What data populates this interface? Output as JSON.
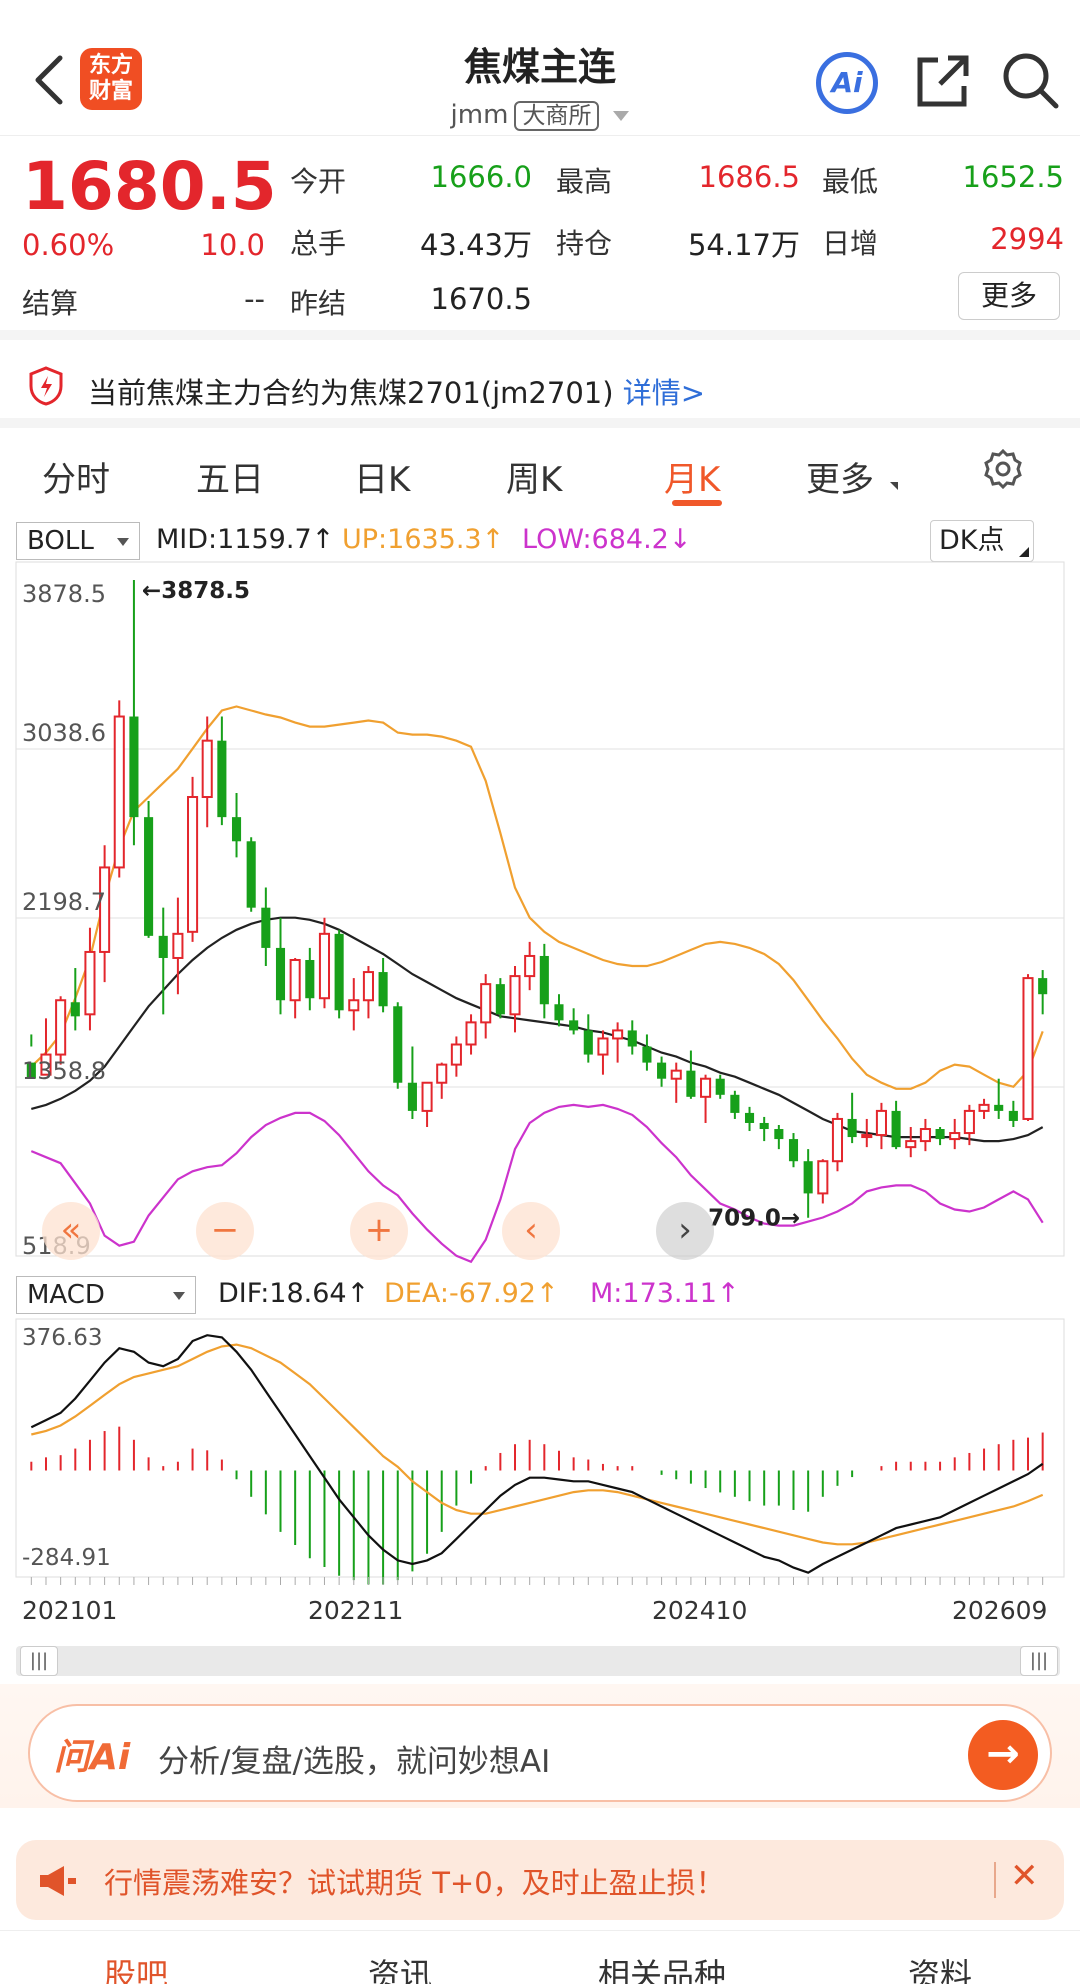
{
  "header": {
    "title": "焦煤主连",
    "code": "jmm",
    "exchange": "大商所",
    "logo_line1": "东方",
    "logo_line2": "财富",
    "ai_label": "Ai"
  },
  "quote": {
    "price": "1680.5",
    "change_pct": "0.60%",
    "change": "10.0",
    "settle_label": "结算",
    "settle_value": "--",
    "open_label": "今开",
    "open_value": "1666.0",
    "high_label": "最高",
    "high_value": "1686.5",
    "low_label": "最低",
    "low_value": "1652.5",
    "volume_label": "总手",
    "volume_value": "43.43万",
    "oi_label": "持仓",
    "oi_value": "54.17万",
    "daily_inc_label": "日增",
    "daily_inc_value": "2994",
    "prev_settle_label": "昨结",
    "prev_settle_value": "1670.5",
    "more_label": "更多"
  },
  "notice": {
    "text": "当前焦煤主力合约为焦煤2701(jm2701)",
    "link": "详情>"
  },
  "tabs": [
    "分时",
    "五日",
    "日K",
    "周K",
    "月K",
    "更多"
  ],
  "active_tab": "月K",
  "boll": {
    "selector": "BOLL",
    "mid": "MID:1159.7↑",
    "up": "UP:1635.3↑",
    "low": "LOW:684.2↓",
    "dk_label": "DK点"
  },
  "macd": {
    "selector": "MACD",
    "dif": "DIF:18.64↑",
    "dea": "DEA:-67.92↑",
    "m": "M:173.11↑"
  },
  "colors": {
    "up": "#e3262c",
    "down": "#17a01a",
    "boll_up": "#f0a030",
    "boll_mid": "#222222",
    "boll_low": "#cc33cc",
    "accent": "#f0582a"
  },
  "chart_data": {
    "type": "candlestick",
    "y_ticks": [
      "3878.5",
      "3038.6",
      "2198.7",
      "1358.8",
      "518.9"
    ],
    "ylim": [
      518.9,
      3878.5
    ],
    "max_marker": "←3878.5",
    "min_marker": "709.0→",
    "x_labels": [
      "202101",
      "202211",
      "202410",
      "202609"
    ],
    "candles": [
      [
        1480,
        1620,
        1560,
        1400
      ],
      [
        1420,
        1700,
        1450,
        1520
      ],
      [
        1520,
        1810,
        1470,
        1790
      ],
      [
        1780,
        1950,
        1640,
        1710
      ],
      [
        1720,
        2150,
        1640,
        2030
      ],
      [
        2030,
        2560,
        1880,
        2450
      ],
      [
        2450,
        3280,
        2400,
        3200
      ],
      [
        3200,
        3878.5,
        2560,
        2700
      ],
      [
        2700,
        2780,
        2100,
        2110
      ],
      [
        2110,
        2250,
        1720,
        2000
      ],
      [
        2000,
        2300,
        1820,
        2120
      ],
      [
        2130,
        2900,
        2080,
        2800
      ],
      [
        2800,
        3200,
        2650,
        3080
      ],
      [
        3080,
        3200,
        2660,
        2700
      ],
      [
        2700,
        2820,
        2500,
        2580
      ],
      [
        2580,
        2600,
        2230,
        2250
      ],
      [
        2250,
        2350,
        1960,
        2050
      ],
      [
        2050,
        2200,
        1720,
        1790
      ],
      [
        1790,
        2000,
        1700,
        1990
      ],
      [
        1990,
        2050,
        1740,
        1800
      ],
      [
        1800,
        2200,
        1750,
        2120
      ],
      [
        2120,
        2140,
        1700,
        1740
      ],
      [
        1740,
        1900,
        1640,
        1790
      ],
      [
        1790,
        1960,
        1700,
        1930
      ],
      [
        1930,
        2000,
        1730,
        1760
      ],
      [
        1760,
        1780,
        1350,
        1380
      ],
      [
        1380,
        1560,
        1200,
        1240
      ],
      [
        1240,
        1380,
        1160,
        1380
      ],
      [
        1380,
        1480,
        1300,
        1470
      ],
      [
        1470,
        1610,
        1410,
        1570
      ],
      [
        1570,
        1720,
        1520,
        1680
      ],
      [
        1680,
        1920,
        1600,
        1870
      ],
      [
        1870,
        1900,
        1700,
        1720
      ],
      [
        1720,
        1960,
        1630,
        1910
      ],
      [
        1910,
        2080,
        1840,
        2010
      ],
      [
        2010,
        2070,
        1700,
        1770
      ],
      [
        1770,
        1820,
        1660,
        1690
      ],
      [
        1690,
        1750,
        1620,
        1640
      ],
      [
        1640,
        1720,
        1480,
        1520
      ],
      [
        1520,
        1640,
        1420,
        1600
      ],
      [
        1600,
        1680,
        1480,
        1640
      ],
      [
        1640,
        1690,
        1520,
        1560
      ],
      [
        1560,
        1620,
        1440,
        1480
      ],
      [
        1480,
        1510,
        1360,
        1400
      ],
      [
        1400,
        1480,
        1280,
        1440
      ],
      [
        1440,
        1540,
        1300,
        1310
      ],
      [
        1310,
        1420,
        1180,
        1400
      ],
      [
        1400,
        1420,
        1300,
        1320
      ],
      [
        1320,
        1340,
        1200,
        1230
      ],
      [
        1230,
        1260,
        1140,
        1180
      ],
      [
        1180,
        1210,
        1090,
        1150
      ],
      [
        1150,
        1170,
        1050,
        1100
      ],
      [
        1100,
        1130,
        960,
        990
      ],
      [
        990,
        1050,
        709,
        830
      ],
      [
        830,
        1000,
        780,
        990
      ],
      [
        990,
        1230,
        940,
        1200
      ],
      [
        1200,
        1330,
        1080,
        1110
      ],
      [
        1110,
        1200,
        1060,
        1120
      ],
      [
        1120,
        1280,
        1050,
        1240
      ],
      [
        1240,
        1290,
        1050,
        1060
      ],
      [
        1060,
        1160,
        1010,
        1090
      ],
      [
        1090,
        1200,
        1040,
        1150
      ],
      [
        1150,
        1160,
        1070,
        1100
      ],
      [
        1100,
        1200,
        1050,
        1130
      ],
      [
        1130,
        1270,
        1070,
        1240
      ],
      [
        1240,
        1300,
        1200,
        1270
      ],
      [
        1270,
        1400,
        1200,
        1240
      ],
      [
        1240,
        1290,
        1160,
        1190
      ],
      [
        1200,
        1920,
        1190,
        1900
      ],
      [
        1900,
        1940,
        1720,
        1820
      ]
    ],
    "boll_up": [
      1460,
      1530,
      1620,
      1800,
      2000,
      2300,
      2550,
      2730,
      2800,
      2870,
      2940,
      3040,
      3140,
      3230,
      3250,
      3230,
      3210,
      3195,
      3170,
      3150,
      3150,
      3160,
      3170,
      3180,
      3170,
      3120,
      3110,
      3110,
      3100,
      3080,
      3050,
      2880,
      2620,
      2350,
      2200,
      2130,
      2080,
      2050,
      2020,
      1990,
      1970,
      1960,
      1960,
      1980,
      2010,
      2040,
      2070,
      2080,
      2070,
      2050,
      2020,
      1970,
      1890,
      1790,
      1690,
      1600,
      1500,
      1420,
      1380,
      1350,
      1350,
      1380,
      1440,
      1470,
      1460,
      1420,
      1380,
      1360,
      1440,
      1635.3
    ],
    "boll_mid": [
      1250,
      1270,
      1300,
      1340,
      1390,
      1460,
      1560,
      1660,
      1760,
      1840,
      1920,
      1990,
      2050,
      2100,
      2140,
      2170,
      2190,
      2200,
      2200,
      2190,
      2170,
      2140,
      2100,
      2060,
      2020,
      1970,
      1920,
      1880,
      1840,
      1800,
      1770,
      1740,
      1710,
      1700,
      1690,
      1680,
      1670,
      1660,
      1640,
      1630,
      1610,
      1590,
      1560,
      1530,
      1510,
      1480,
      1460,
      1430,
      1410,
      1380,
      1350,
      1320,
      1280,
      1240,
      1200,
      1170,
      1140,
      1130,
      1120,
      1110,
      1110,
      1110,
      1110,
      1110,
      1100,
      1090,
      1090,
      1100,
      1120,
      1159.7
    ],
    "boll_low": [
      1040,
      1010,
      980,
      880,
      780,
      620,
      570,
      590,
      720,
      810,
      900,
      940,
      960,
      970,
      1030,
      1110,
      1170,
      1205,
      1230,
      1230,
      1190,
      1120,
      1030,
      940,
      870,
      820,
      730,
      650,
      580,
      520,
      490,
      600,
      800,
      1050,
      1180,
      1230,
      1260,
      1270,
      1260,
      1270,
      1250,
      1220,
      1160,
      1080,
      1010,
      920,
      850,
      780,
      750,
      710,
      680,
      670,
      670,
      690,
      710,
      740,
      780,
      840,
      860,
      870,
      870,
      840,
      780,
      750,
      740,
      760,
      800,
      840,
      800,
      684.2
    ],
    "macd_ylim": [
      -284.91,
      376.63
    ],
    "macd_ticks": [
      "376.63",
      "-284.91"
    ],
    "dif": [
      120,
      140,
      160,
      200,
      250,
      300,
      340,
      330,
      300,
      290,
      310,
      360,
      376,
      370,
      330,
      280,
      220,
      160,
      100,
      40,
      -20,
      -80,
      -130,
      -180,
      -220,
      -250,
      -260,
      -250,
      -230,
      -190,
      -150,
      -110,
      -70,
      -40,
      -20,
      -20,
      -25,
      -30,
      -30,
      -40,
      -50,
      -60,
      -80,
      -100,
      -120,
      -140,
      -160,
      -180,
      -200,
      -220,
      -240,
      -250,
      -270,
      -284,
      -260,
      -240,
      -220,
      -200,
      -180,
      -160,
      -150,
      -140,
      -130,
      -110,
      -90,
      -70,
      -50,
      -30,
      -10,
      18.64
    ],
    "dea": [
      100,
      110,
      125,
      150,
      180,
      210,
      240,
      260,
      270,
      280,
      290,
      310,
      330,
      345,
      350,
      340,
      320,
      300,
      270,
      240,
      200,
      160,
      120,
      80,
      40,
      10,
      -30,
      -60,
      -90,
      -110,
      -120,
      -120,
      -110,
      -100,
      -90,
      -80,
      -70,
      -60,
      -55,
      -55,
      -60,
      -70,
      -80,
      -90,
      -100,
      -110,
      -120,
      -130,
      -140,
      -150,
      -160,
      -170,
      -180,
      -190,
      -200,
      -205,
      -205,
      -200,
      -190,
      -180,
      -170,
      -160,
      -150,
      -140,
      -130,
      -120,
      -110,
      -100,
      -85,
      -67.92
    ],
    "hist": [
      40,
      60,
      70,
      100,
      140,
      180,
      200,
      140,
      60,
      20,
      40,
      100,
      92,
      50,
      -40,
      -120,
      -200,
      -280,
      -340,
      -400,
      -440,
      -480,
      -500,
      -520,
      -520,
      -500,
      -460,
      -380,
      -280,
      -160,
      -60,
      20,
      80,
      120,
      140,
      120,
      90,
      60,
      50,
      30,
      20,
      20,
      0,
      -20,
      -40,
      -60,
      -80,
      -100,
      -120,
      -140,
      -160,
      -160,
      -180,
      -188,
      -120,
      -70,
      -30,
      0,
      20,
      40,
      40,
      40,
      40,
      60,
      80,
      100,
      120,
      140,
      150,
      173.11
    ]
  },
  "controls": {
    "zoom_out": "−",
    "zoom_in": "+",
    "prev": "‹",
    "next": "›",
    "fast_back": "«",
    "grip": "|||"
  },
  "ai_search": {
    "logo": "问Ai",
    "placeholder": "分析/复盘/选股，就问妙想AI",
    "go": "→"
  },
  "promo": {
    "text": "行情震荡难安？试试期货 T+0，及时止盈止损！",
    "close": "✕"
  },
  "bottom_tabs": [
    "股吧",
    "资讯",
    "相关品种",
    "资料"
  ]
}
